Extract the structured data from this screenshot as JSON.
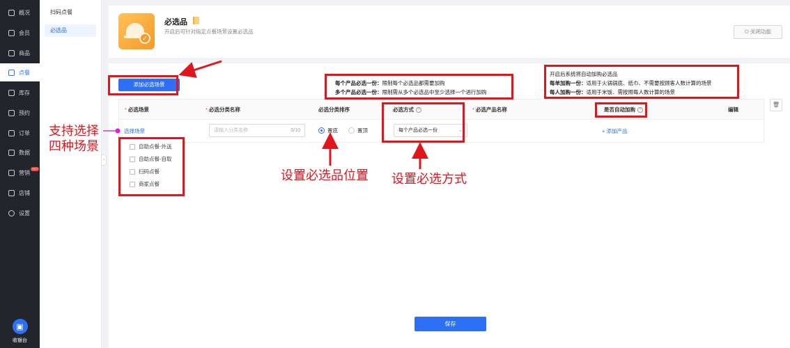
{
  "sidebar": {
    "items": [
      {
        "label": "概况"
      },
      {
        "label": "会员"
      },
      {
        "label": "商品"
      },
      {
        "label": "点餐"
      },
      {
        "label": "库存"
      },
      {
        "label": "预约"
      },
      {
        "label": "订单"
      },
      {
        "label": "数据"
      },
      {
        "label": "营销",
        "badge": "HOT"
      },
      {
        "label": "店铺"
      },
      {
        "label": "设置"
      }
    ],
    "active": "点餐",
    "cashier_label": "收银台"
  },
  "submenu": {
    "items": [
      {
        "label": "扫码点餐"
      },
      {
        "label": "必选品"
      }
    ],
    "active": "必选品"
  },
  "header": {
    "title": "必选品",
    "description": "开启后可针对指定点餐场景设置必选品",
    "close_button": "关闭功能"
  },
  "toolbar": {
    "add_scene_button": "添加必选场景"
  },
  "table": {
    "columns": [
      "必选场景",
      "必选分类名称",
      "必选分类排序",
      "必选方式",
      "必选产品名称",
      "是否自动加购",
      "编辑"
    ],
    "row": {
      "scene_link": "选择场景",
      "name_placeholder": "请输入分类名称",
      "name_count": "0/10",
      "sort_top": "置底",
      "sort_bottom": "置顶",
      "method_value": "每个产品必选一份",
      "add_product": "+ 添加产品"
    }
  },
  "scene_dropdown": {
    "options": [
      "自助点餐-外送",
      "自助点餐-自取",
      "扫码点餐",
      "商家点餐"
    ]
  },
  "save_button": "保存",
  "annotations": {
    "method_note": {
      "line1_bold": "每个产品必选一份：",
      "line1": "限制每个必选品都需要加购",
      "line2_bold": "多个产品必选一份：",
      "line2": "限制需从多个必选品中至少选择一个进行加购"
    },
    "auto_note": {
      "line1": "开启后系统将自动加购必选品",
      "line2_bold": "每单加购一份：",
      "line2": "适用于火锅锅底、纸巾、不需要按顾客人数计算的场景",
      "line3_bold": "每人加购一份：",
      "line3": "适用于米饭、需按照每人数计算的场景"
    },
    "support_scene": [
      "支持选择",
      "四种场景"
    ],
    "set_position": "设置必选品位置",
    "set_method": "设置必选方式"
  },
  "colors": {
    "primary": "#2d6ff7",
    "annotation_red": "#e0161d",
    "sidebar_bg": "#23252d"
  }
}
